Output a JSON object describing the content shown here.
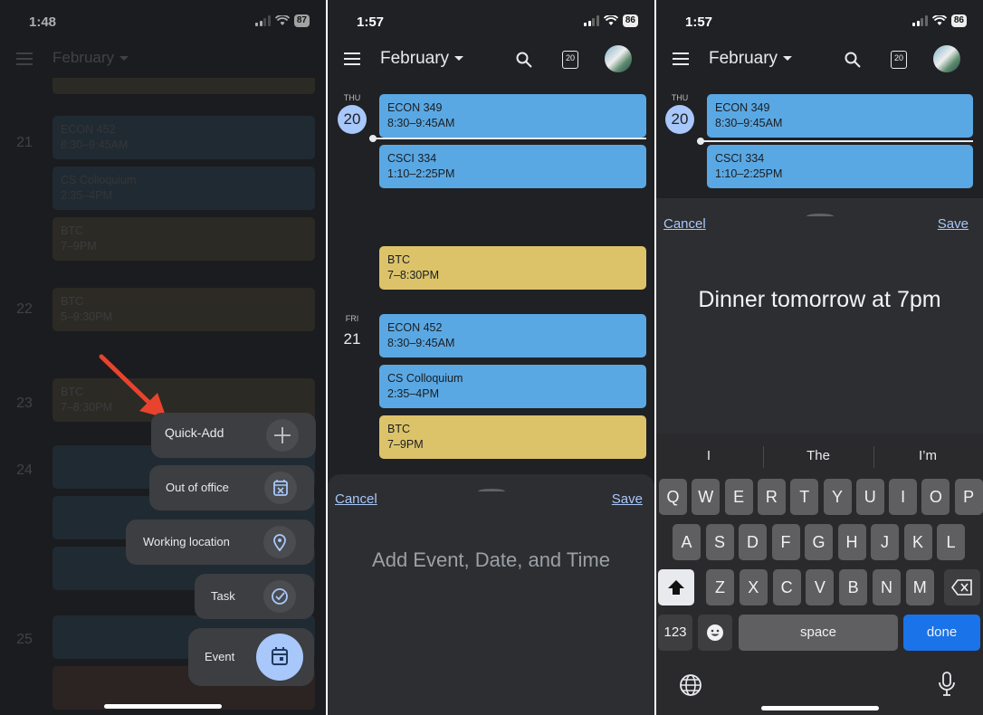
{
  "panel1": {
    "time": "1:48",
    "battery": "87",
    "bg_month": "February",
    "bg_days": [
      "21",
      "22",
      "23",
      "24",
      "25"
    ],
    "bg_events": [
      {
        "title": "ECON 452",
        "time": "8:30–9:45AM",
        "color": "#3a6c8e"
      },
      {
        "title": "CS Colloquium",
        "time": "2:35–4PM",
        "color": "#3a6c8e"
      },
      {
        "title": "BTC",
        "time": "7–9PM",
        "color": "#7f7240"
      },
      {
        "title": "BTC",
        "time": "5–9:30PM",
        "color": "#7f7240"
      },
      {
        "title": "BTC",
        "time": "7–8:30PM",
        "color": "#7f7240"
      }
    ],
    "menu": [
      {
        "label": "Quick-Add",
        "icon": "plus-icon"
      },
      {
        "label": "Out of office",
        "icon": "calendar-x-icon"
      },
      {
        "label": "Working location",
        "icon": "location-pin-icon"
      },
      {
        "label": "Task",
        "icon": "check-circle-icon"
      },
      {
        "label": "Event",
        "icon": "calendar-icon"
      }
    ],
    "arrow_color": "#e8432d"
  },
  "panel2": {
    "time": "1:57",
    "battery": "86",
    "month": "February",
    "today_badge": "20",
    "days": [
      {
        "name": "THU",
        "num": "20"
      },
      {
        "name": "FRI",
        "num": "21"
      }
    ],
    "events": [
      {
        "title": "ECON 349",
        "time": "8:30–9:45AM",
        "color": "blue"
      },
      {
        "title": "CSCI 334",
        "time": "1:10–2:25PM",
        "color": "blue"
      },
      {
        "title": "BTC",
        "time": "7–8:30PM",
        "color": "yellow"
      },
      {
        "title": "ECON 452",
        "time": "8:30–9:45AM",
        "color": "blue"
      },
      {
        "title": "CS Colloquium",
        "time": "2:35–4PM",
        "color": "blue"
      },
      {
        "title": "BTC",
        "time": "7–9PM",
        "color": "yellow"
      }
    ],
    "cancel": "Cancel",
    "save": "Save",
    "placeholder": "Add Event, Date, and Time"
  },
  "panel3": {
    "time": "1:57",
    "battery": "86",
    "month": "February",
    "today_badge": "20",
    "day": {
      "name": "THU",
      "num": "20"
    },
    "events": [
      {
        "title": "ECON 349",
        "time": "8:30–9:45AM"
      },
      {
        "title": "CSCI 334",
        "time": "1:10–2:25PM"
      }
    ],
    "cancel": "Cancel",
    "save": "Save",
    "input_text": "Dinner tomorrow at 7pm",
    "suggestions": [
      "I",
      "The",
      "I’m"
    ],
    "keys_row1": [
      "Q",
      "W",
      "E",
      "R",
      "T",
      "Y",
      "U",
      "I",
      "O",
      "P"
    ],
    "keys_row2": [
      "A",
      "S",
      "D",
      "F",
      "G",
      "H",
      "J",
      "K",
      "L"
    ],
    "keys_row3": [
      "Z",
      "X",
      "C",
      "V",
      "B",
      "N",
      "M"
    ],
    "key_123": "123",
    "key_space": "space",
    "key_done": "done"
  },
  "colors": {
    "background": "#202124",
    "event_blue": "#5aa8e3",
    "event_yellow": "#dcc36a",
    "accent": "#a8c7fa",
    "keyboard_done": "#1a73e8"
  }
}
